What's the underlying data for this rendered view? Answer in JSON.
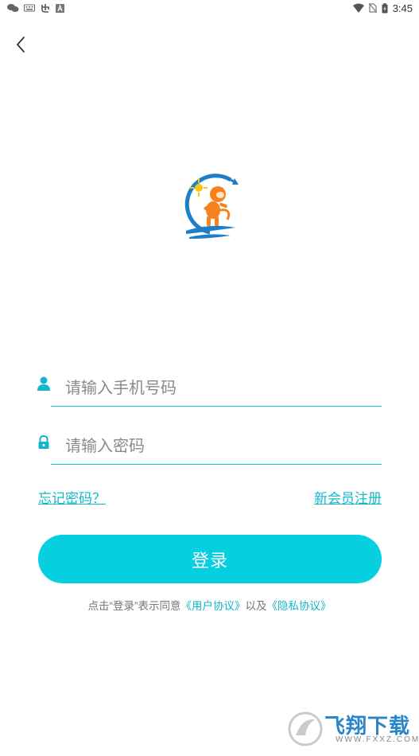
{
  "status_bar": {
    "time": "3:45",
    "left_icons": [
      "wechat-icon",
      "keyboard-icon",
      "app-icon",
      "a-icon"
    ],
    "right_icons": [
      "wifi-icon",
      "no-sim-icon",
      "battery-icon"
    ]
  },
  "header": {
    "back_icon": "chevron-left-icon"
  },
  "form": {
    "phone": {
      "placeholder": "请输入手机号码",
      "value": ""
    },
    "password": {
      "placeholder": "请输入密码",
      "value": ""
    }
  },
  "links": {
    "forgot_password": "忘记密码？",
    "register": "新会员注册"
  },
  "login_button": "登录",
  "agreement": {
    "prefix": "点击“登录”表示同意",
    "user_agreement": "《用户协议》",
    "and": "以及",
    "privacy_policy": "《隐私协议》"
  },
  "watermark": {
    "text": "飞翔下载",
    "url": "WWW.FXXZ.COM"
  },
  "colors": {
    "accent": "#06cfe0",
    "link": "#13b7cc",
    "logo_orange": "#f5821f",
    "logo_blue": "#1e7fc9"
  }
}
